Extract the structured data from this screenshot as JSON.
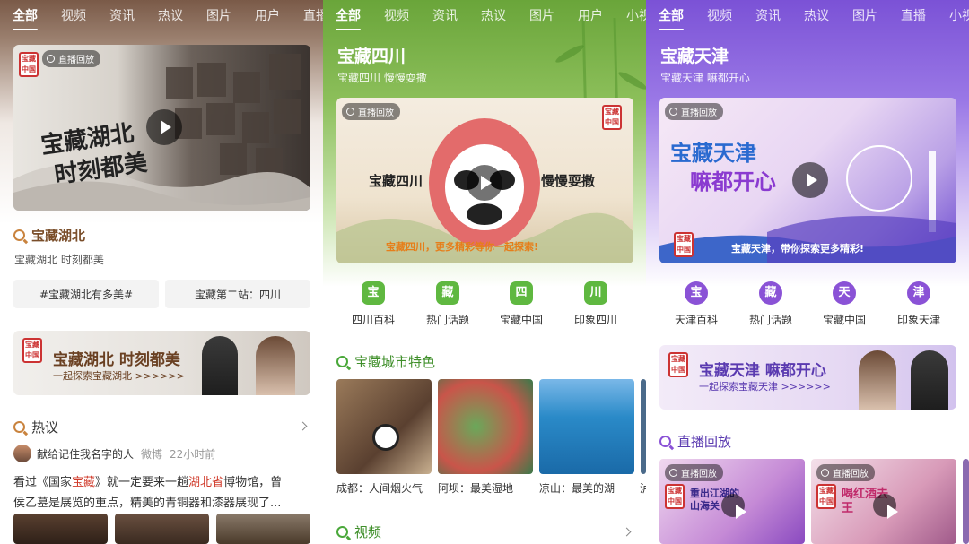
{
  "panel1": {
    "tabs": [
      "全部",
      "视频",
      "资讯",
      "热议",
      "图片",
      "用户",
      "直播"
    ],
    "banner": {
      "live_label": "直播回放",
      "big_text_line1": "宝藏湖北",
      "big_text_line2": "时刻都美",
      "seal": "宝藏中国"
    },
    "section_title": "宝藏湖北",
    "subtitle": "宝藏湖北 时刻都美",
    "pills": [
      "#宝藏湖北有多美#",
      "宝藏第二站：四川"
    ],
    "promo": {
      "title": "宝藏湖北 时刻都美",
      "sub": "一起探索宝藏湖北 >>>>>>"
    },
    "hot": {
      "title": "热议",
      "user": "献给记住我名字的人",
      "source": "微博",
      "time": "22小时前",
      "line1_a": "看过《国家",
      "line1_hl1": "宝藏",
      "line1_b": "》就一定要来一趟",
      "line1_hl2": "湖北省",
      "line1_c": "博物馆，曾",
      "line2": "侯乙墓是展览的重点，精美的青铜器和漆器展现了..."
    }
  },
  "panel2": {
    "tabs": [
      "全部",
      "视频",
      "资讯",
      "热议",
      "图片",
      "用户",
      "小视"
    ],
    "title": "宝藏四川",
    "subtitle": "宝藏四川 慢慢耍撒",
    "banner": {
      "live_label": "直播回放",
      "left_text": "宝藏四川",
      "right_text": "慢慢耍撒",
      "tagline": "宝藏四川，更多精彩等你一起探索!"
    },
    "icons": [
      {
        "glyph": "宝",
        "label": "四川百科",
        "color": "#5fb840"
      },
      {
        "glyph": "藏",
        "label": "热门话题",
        "color": "#5fb840"
      },
      {
        "glyph": "四",
        "label": "宝藏中国",
        "color": "#5fb840"
      },
      {
        "glyph": "川",
        "label": "印象四川",
        "color": "#5fb840"
      }
    ],
    "section_title": "宝藏城市特色",
    "cards": [
      {
        "caption": "成都：人间烟火气"
      },
      {
        "caption": "阿坝：最美湿地"
      },
      {
        "caption": "凉山：最美的湖"
      },
      {
        "caption": "泸"
      }
    ],
    "video_title": "视频"
  },
  "panel3": {
    "tabs": [
      "全部",
      "视频",
      "资讯",
      "热议",
      "图片",
      "直播",
      "小视"
    ],
    "title": "宝藏天津",
    "subtitle": "宝藏天津 嘛都开心",
    "banner": {
      "live_label": "直播回放",
      "line1": "宝藏天津",
      "line2": "嘛都开心",
      "tagline": "宝藏天津，带你探索更多精彩!"
    },
    "icons": [
      {
        "glyph": "宝",
        "label": "天津百科",
        "color": "#8a52d6"
      },
      {
        "glyph": "藏",
        "label": "热门话题",
        "color": "#8a52d6"
      },
      {
        "glyph": "天",
        "label": "宝藏中国",
        "color": "#8a52d6"
      },
      {
        "glyph": "津",
        "label": "印象天津",
        "color": "#8a52d6"
      }
    ],
    "promo": {
      "title": "宝藏天津 嘛都开心",
      "sub": "一起探索宝藏天津 >>>>>>"
    },
    "section_title": "直播回放",
    "live_cards": [
      {
        "label": "直播回放",
        "text": "重出江湖的山海关"
      },
      {
        "label": "直播回放",
        "text": "喝红酒去王"
      }
    ]
  }
}
